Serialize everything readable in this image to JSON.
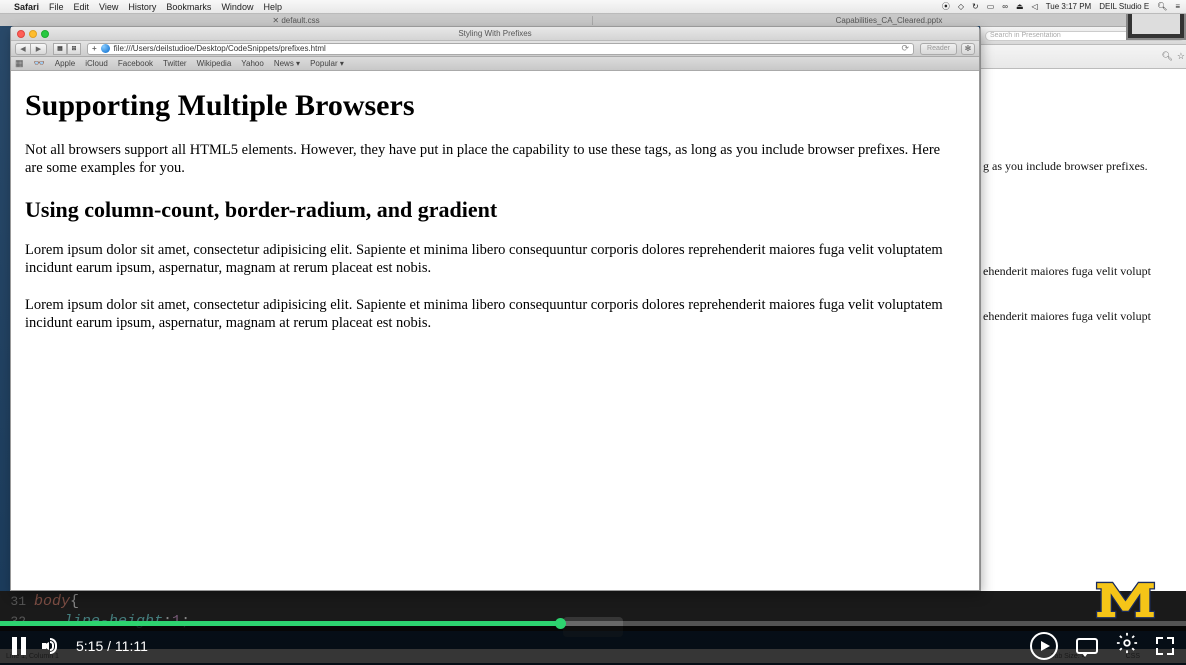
{
  "menubar": {
    "app": "Safari",
    "items": [
      "File",
      "Edit",
      "View",
      "History",
      "Bookmarks",
      "Window",
      "Help"
    ],
    "right": {
      "user": "DEIL Studio E",
      "time": "Tue 3:17 PM",
      "battery_pct": ""
    }
  },
  "bg_tabs": {
    "tab1": "✕  default.css",
    "tab2": "Capabilities_CA_Cleared.pptx"
  },
  "bg_window": {
    "search_placeholder": "Search in Presentation",
    "content_line1": "g as you include browser prefixes.",
    "content_line2": "ehenderit maiores fuga velit volupt",
    "content_line3": "ehenderit maiores fuga velit volupt"
  },
  "safari": {
    "title": "Styling With Prefixes",
    "url": "file:///Users/deilstudioe/Desktop/CodeSnippets/prefixes.html",
    "reader": "Reader",
    "bookmarks": [
      "Apple",
      "iCloud",
      "Facebook",
      "Twitter",
      "Wikipedia",
      "Yahoo",
      "News ▾",
      "Popular ▾"
    ]
  },
  "page": {
    "h1": "Supporting Multiple Browsers",
    "intro": "Not all browsers support all HTML5 elements. However, they have put in place the capability to use these tags, as long as you include browser prefixes. Here are some examples for you.",
    "h2": "Using column-count, border-radium, and gradient",
    "lorem1": "Lorem ipsum dolor sit amet, consectetur adipisicing elit. Sapiente et minima libero consequuntur corporis dolores reprehenderit maiores fuga velit voluptatem incidunt earum ipsum, aspernatur, magnam at rerum placeat est nobis.",
    "lorem2": "Lorem ipsum dolor sit amet, consectetur adipisicing elit. Sapiente et minima libero consequuntur corporis dolores reprehenderit maiores fuga velit voluptatem incidunt earum ipsum, aspernatur, magnam at rerum placeat est nobis."
  },
  "editor": {
    "line31_num": "31",
    "line31_sel": "body",
    "line31_brace": " {",
    "line32_num": "32",
    "line32_prop": "line-height",
    "line32_punc1": ": ",
    "line32_val": "1",
    "line32_punc2": ";",
    "status_left": "Line 1, Column 1",
    "status_tabsize": "Tab Size: 4",
    "status_lang": "CSS"
  },
  "video": {
    "current": "5:15",
    "sep": " / ",
    "total": "11:11",
    "played_pct": 47.2
  }
}
